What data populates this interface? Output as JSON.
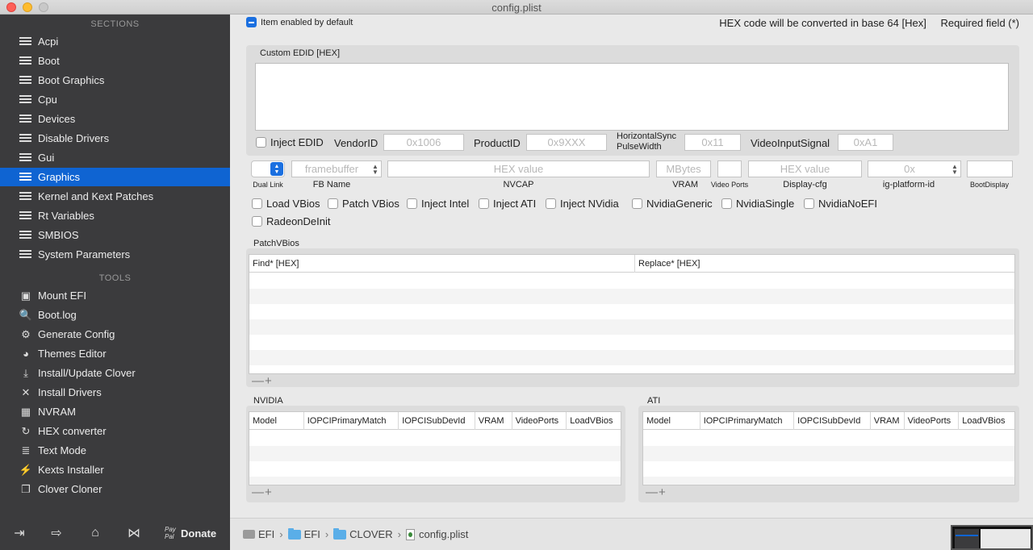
{
  "window": {
    "title": "config.plist"
  },
  "sidebar": {
    "sections_label": "SECTIONS",
    "tools_label": "TOOLS",
    "sections": [
      {
        "label": "Acpi",
        "icon": "list-icon"
      },
      {
        "label": "Boot",
        "icon": "list-icon"
      },
      {
        "label": "Boot Graphics",
        "icon": "list-icon"
      },
      {
        "label": "Cpu",
        "icon": "list-icon"
      },
      {
        "label": "Devices",
        "icon": "list-icon"
      },
      {
        "label": "Disable Drivers",
        "icon": "list-icon"
      },
      {
        "label": "Gui",
        "icon": "list-icon"
      },
      {
        "label": "Graphics",
        "icon": "list-icon",
        "selected": true
      },
      {
        "label": "Kernel and Kext Patches",
        "icon": "list-icon"
      },
      {
        "label": "Rt Variables",
        "icon": "list-icon"
      },
      {
        "label": "SMBIOS",
        "icon": "list-icon"
      },
      {
        "label": "System Parameters",
        "icon": "list-icon"
      }
    ],
    "tools": [
      {
        "label": "Mount EFI",
        "icon": "disk-icon"
      },
      {
        "label": "Boot.log",
        "icon": "log-search-icon"
      },
      {
        "label": "Generate Config",
        "icon": "gears-icon"
      },
      {
        "label": "Themes Editor",
        "icon": "palette-icon"
      },
      {
        "label": "Install/Update Clover",
        "icon": "download-icon"
      },
      {
        "label": "Install Drivers",
        "icon": "tools-icon"
      },
      {
        "label": "NVRAM",
        "icon": "chip-icon"
      },
      {
        "label": "HEX converter",
        "icon": "convert-icon"
      },
      {
        "label": "Text Mode",
        "icon": "text-icon"
      },
      {
        "label": "Kexts Installer",
        "icon": "plug-icon"
      },
      {
        "label": "Clover Cloner",
        "icon": "clone-icon"
      }
    ],
    "donate_label": "Donate",
    "paypal_label": "Pay Pal"
  },
  "top": {
    "enabled_label": "Item enabled by default",
    "hex_note": "HEX code will be converted in base 64 [Hex]",
    "required_note": "Required field (*)"
  },
  "edid": {
    "group_label": "Custom EDID [HEX]",
    "inject_label": "Inject EDID",
    "vendor_label": "VendorID",
    "vendor_placeholder": "0x1006",
    "product_label": "ProductID",
    "product_placeholder": "0x9XXX",
    "hsync_label_1": "HorizontalSync",
    "hsync_label_2": "PulseWidth",
    "hsync_placeholder": "0x11",
    "vis_label": "VideoInputSignal",
    "vis_placeholder": "0xA1"
  },
  "gfx": {
    "dual_link_label": "Dual Link",
    "fb_placeholder": "framebuffer",
    "fb_label": "FB Name",
    "nvcap_placeholder": "HEX value",
    "nvcap_label": "NVCAP",
    "vram_placeholder": "MBytes",
    "vram_label": "VRAM",
    "ports_label": "Video Ports",
    "dcfg_placeholder": "HEX value",
    "dcfg_label": "Display-cfg",
    "igp_placeholder": "0x",
    "igp_label": "ig-platform-id",
    "bootdisplay_label": "BootDisplay",
    "checks": [
      "Load VBios",
      "Patch VBios",
      "Inject Intel",
      "Inject ATI",
      "Inject NVidia",
      "NvidiaGeneric",
      "NvidiaSingle",
      "NvidiaNoEFI"
    ],
    "checks2": [
      "RadeonDeInit"
    ]
  },
  "patchvbios": {
    "group_label": "PatchVBios",
    "columns": [
      "Find* [HEX]",
      "Replace* [HEX]"
    ]
  },
  "nvidia": {
    "group_label": "NVIDIA",
    "columns": [
      "Model",
      "IOPCIPrimaryMatch",
      "IOPCISubDevId",
      "VRAM",
      "VideoPorts",
      "LoadVBios"
    ]
  },
  "ati": {
    "group_label": "ATI",
    "columns": [
      "Model",
      "IOPCIPrimaryMatch",
      "IOPCISubDevId",
      "VRAM",
      "VideoPorts",
      "LoadVBios"
    ]
  },
  "controls": {
    "minus": "—",
    "plus": "+"
  },
  "path": {
    "items": [
      "EFI",
      "EFI",
      "CLOVER",
      "config.plist"
    ]
  }
}
